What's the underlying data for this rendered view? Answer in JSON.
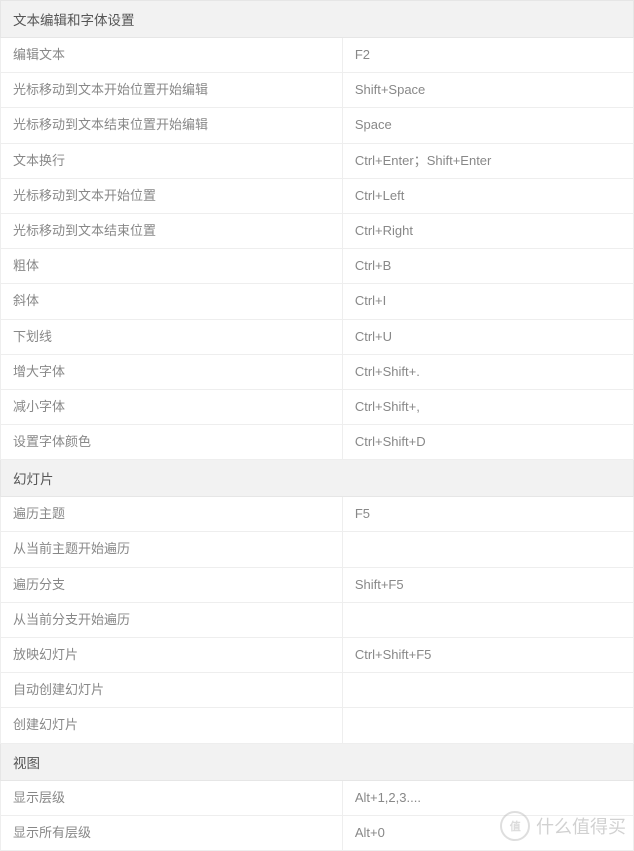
{
  "sections": [
    {
      "title": "文本编辑和字体设置",
      "rows": [
        {
          "action": "编辑文本",
          "shortcut": "F2"
        },
        {
          "action": "光标移动到文本开始位置开始编辑",
          "shortcut": "Shift+Space"
        },
        {
          "action": "光标移动到文本结束位置开始编辑",
          "shortcut": "Space"
        },
        {
          "action": "文本换行",
          "shortcut": "Ctrl+Enter；Shift+Enter"
        },
        {
          "action": "光标移动到文本开始位置",
          "shortcut": "Ctrl+Left"
        },
        {
          "action": "光标移动到文本结束位置",
          "shortcut": "Ctrl+Right"
        },
        {
          "action": "粗体",
          "shortcut": "Ctrl+B"
        },
        {
          "action": "斜体",
          "shortcut": "Ctrl+I"
        },
        {
          "action": "下划线",
          "shortcut": "Ctrl+U"
        },
        {
          "action": "增大字体",
          "shortcut": "Ctrl+Shift+."
        },
        {
          "action": "减小字体",
          "shortcut": "Ctrl+Shift+,"
        },
        {
          "action": "设置字体颜色",
          "shortcut": "Ctrl+Shift+D"
        }
      ]
    },
    {
      "title": "幻灯片",
      "rows": [
        {
          "action": "遍历主题",
          "shortcut": "F5"
        },
        {
          "action": "从当前主题开始遍历",
          "shortcut": ""
        },
        {
          "action": "遍历分支",
          "shortcut": "Shift+F5"
        },
        {
          "action": "从当前分支开始遍历",
          "shortcut": ""
        },
        {
          "action": "放映幻灯片",
          "shortcut": "Ctrl+Shift+F5"
        },
        {
          "action": "自动创建幻灯片",
          "shortcut": ""
        },
        {
          "action": "创建幻灯片",
          "shortcut": ""
        }
      ]
    },
    {
      "title": "视图",
      "rows": [
        {
          "action": "显示层级",
          "shortcut": "Alt+1,2,3...."
        },
        {
          "action": "显示所有层级",
          "shortcut": "Alt+0"
        }
      ]
    }
  ],
  "watermark": {
    "logo_text": "值",
    "text": "什么值得买"
  }
}
